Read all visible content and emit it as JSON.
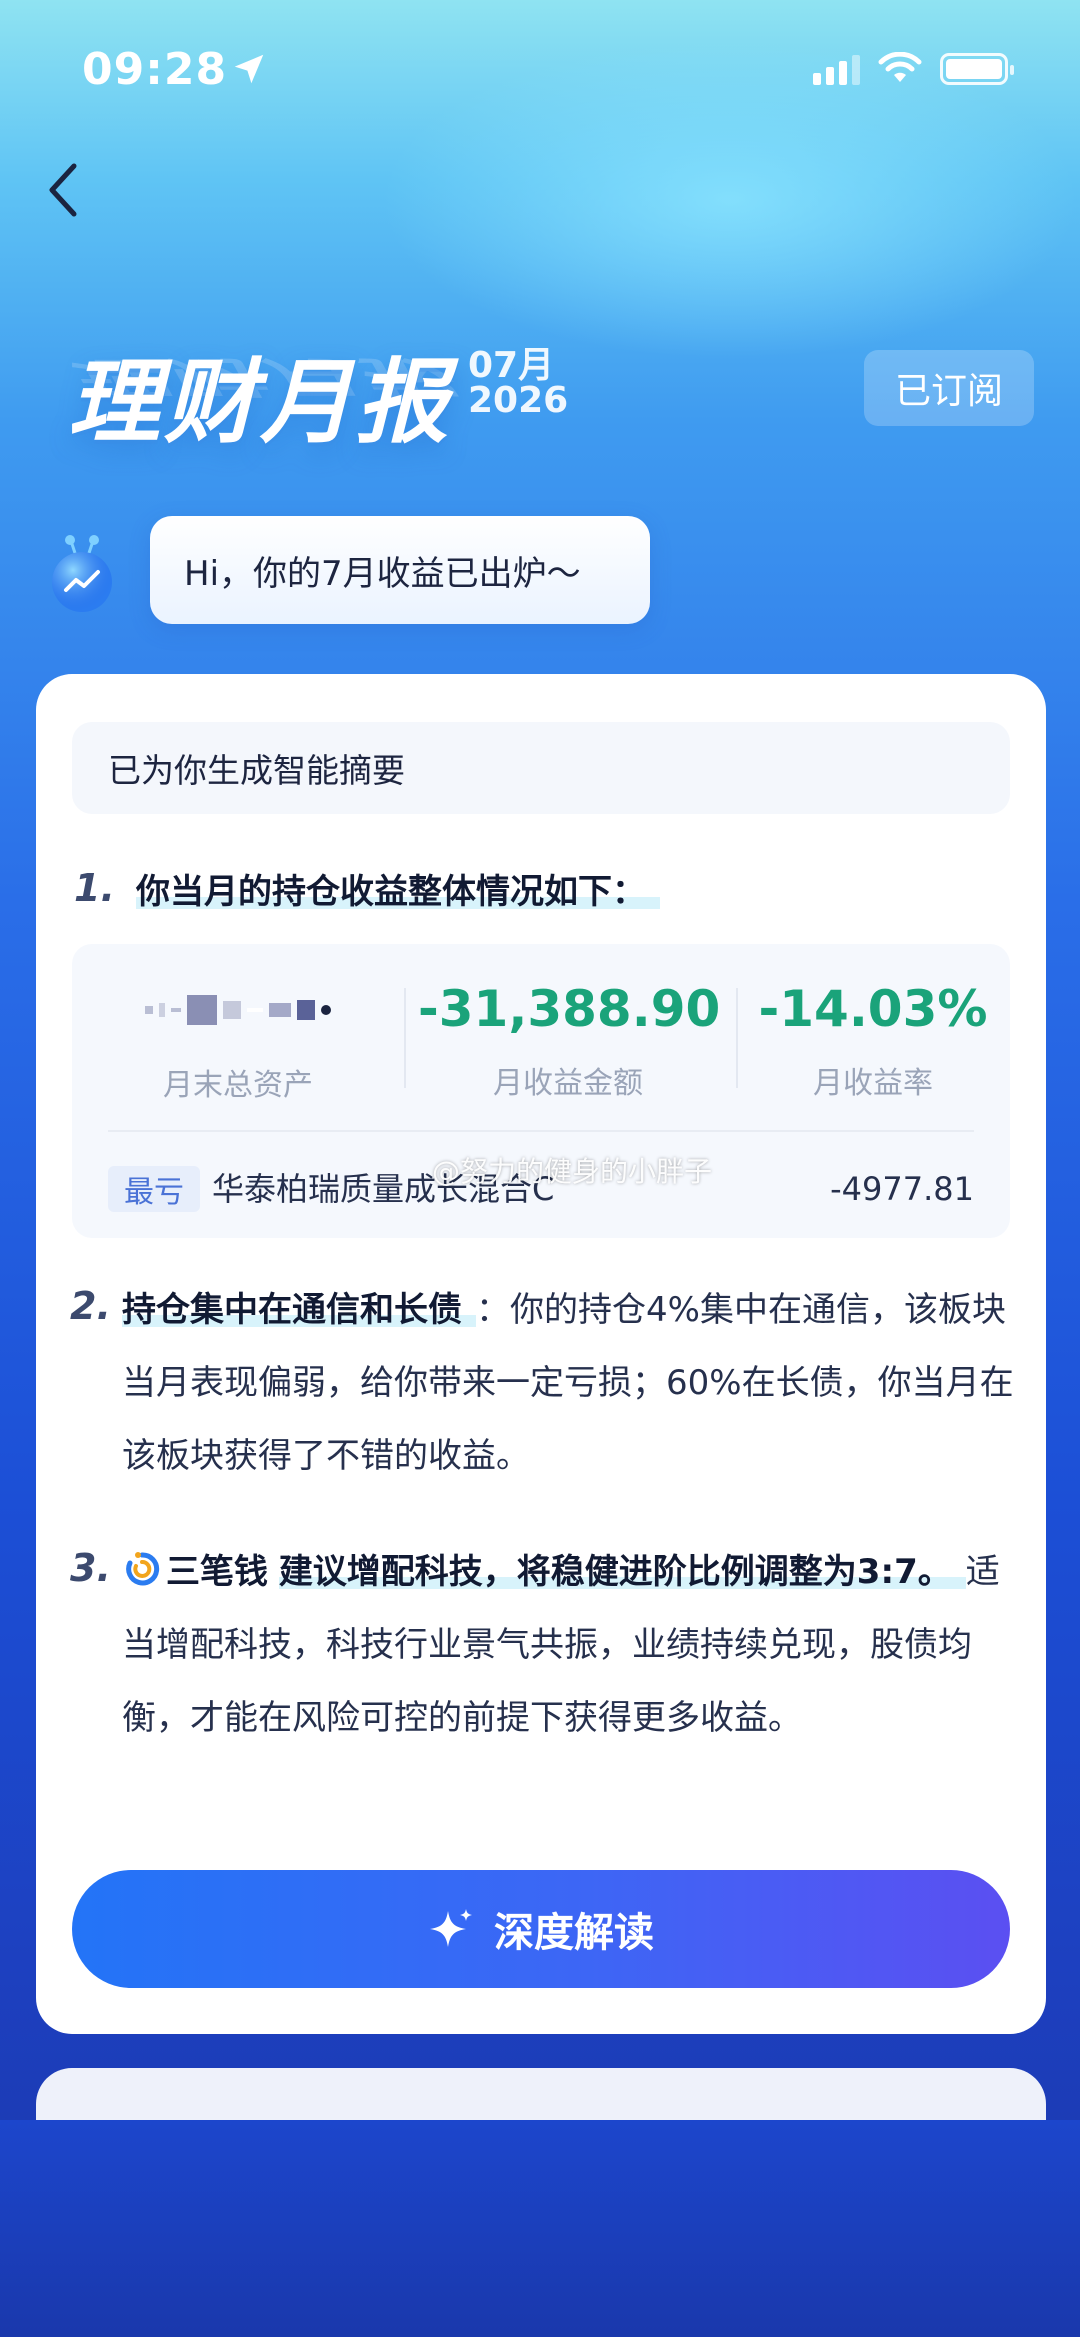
{
  "status_bar": {
    "time": "09:28"
  },
  "header": {
    "title": "理财月报",
    "month": "07月",
    "year": "2026",
    "subscribe_label": "已订阅"
  },
  "greeting": "Hi，你的7月收益已出炉～",
  "summary": {
    "intro": "已为你生成智能摘要",
    "section1": {
      "number": "1.",
      "heading": "你当月的持仓收益整体情况如下：",
      "stats": [
        {
          "value": "",
          "label": "月末总资产"
        },
        {
          "value": "-31,388.90",
          "label": "月收益金额"
        },
        {
          "value": "-14.03%",
          "label": "月收益率"
        }
      ],
      "loss_tag": "最亏",
      "fund_name": "华泰柏瑞质量成长混合C",
      "fund_value": "-4977.81",
      "watermark": "@努力的健身的小胖子"
    },
    "section2": {
      "number": "2.",
      "heading": "持仓集中在通信和长债",
      "body": "：你的持仓4%集中在通信，该板块当月表现偏弱，给你带来一定亏损；60%在长债，你当月在该板块获得了不错的收益。"
    },
    "section3": {
      "number": "3.",
      "brand": "三笔钱",
      "heading": "建议增配科技，将稳健进阶比例调整为3:7。",
      "body": "适当增配科技，科技行业景气共振，业绩持续兑现，股债均衡，才能在风险可控的前提下获得更多收益。"
    }
  },
  "cta_label": "深度解读",
  "colors": {
    "gain_loss_green": "#1aa37a",
    "accent_blue": "#2374f7",
    "accent_purple": "#5b4ff2"
  },
  "icons": [
    "location-arrow-icon",
    "signal-icon",
    "wifi-icon",
    "battery-icon",
    "back-chevron-icon",
    "mascot-icon",
    "swirl-logo-icon",
    "sparkle-icon"
  ]
}
